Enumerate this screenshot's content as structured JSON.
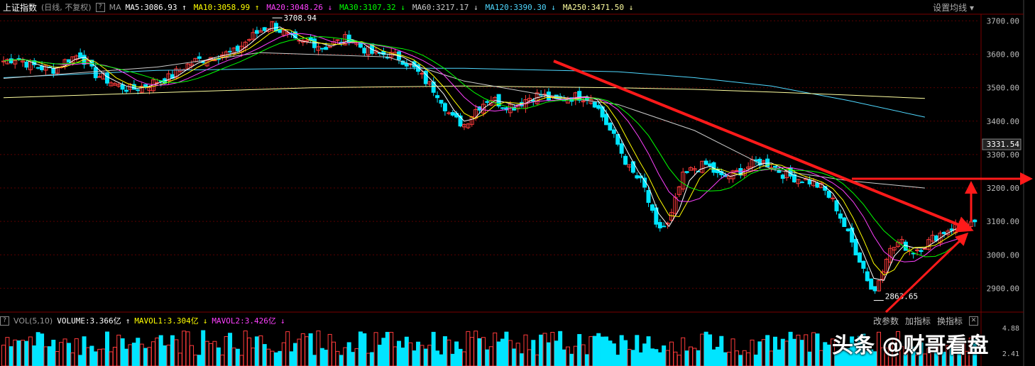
{
  "header": {
    "index_name": "上证指数",
    "period": "(日线, 不复权)",
    "ma_prefix": "MA",
    "settings_label": "设置均线",
    "ma": [
      {
        "label": "MA5:3086.93",
        "arrow": "↑",
        "color": "#ffffff"
      },
      {
        "label": "MA10:3058.99",
        "arrow": "↑",
        "color": "#ffff00"
      },
      {
        "label": "MA20:3048.26",
        "arrow": "↓",
        "color": "#ff40ff"
      },
      {
        "label": "MA30:3107.32",
        "arrow": "↓",
        "color": "#00ff00"
      },
      {
        "label": "MA60:3217.17",
        "arrow": "↓",
        "color": "#cccccc"
      },
      {
        "label": "MA120:3390.30",
        "arrow": "↓",
        "color": "#4fd8ff"
      },
      {
        "label": "MA250:3471.50",
        "arrow": "↓",
        "color": "#ffffa0"
      }
    ]
  },
  "vol_header": {
    "label": "VOL(5,10)",
    "volume": "VOLUME:3.366亿",
    "volume_arrow": "↑",
    "mavol1": "MAVOL1:3.304亿",
    "mavol1_arrow": "↓",
    "mavol2": "MAVOL2:3.426亿",
    "mavol2_arrow": "↓"
  },
  "vol_tools": [
    "改参数",
    "加指标",
    "换指标"
  ],
  "watermark": "头条 @财哥看盘",
  "price_axis": {
    "ticks": [
      "3700.00",
      "3600.00",
      "3500.00",
      "3400.00",
      "3300.00",
      "3200.00",
      "3100.00",
      "3000.00",
      "2900.00"
    ],
    "current": "3331.54"
  },
  "vol_axis_ticks": [
    "4.88",
    "2.41"
  ],
  "annotations": {
    "high_label": "3708.94",
    "low_label": "2863.65"
  },
  "colors": {
    "up": "#ff3b3b",
    "down": "#00e5ff",
    "arrow": "#ff1a1a",
    "grid": "#5a0000"
  },
  "chart_data": {
    "type": "candlestick",
    "ylim": [
      2850,
      3720
    ],
    "high": 3708.94,
    "low": 2863.65,
    "ma_series": {
      "MA120": [
        [
          0,
          3530
        ],
        [
          60,
          3552
        ],
        [
          120,
          3558
        ],
        [
          180,
          3558
        ],
        [
          240,
          3548
        ],
        [
          270,
          3530
        ],
        [
          300,
          3505
        ],
        [
          330,
          3462
        ],
        [
          360,
          3412
        ]
      ],
      "MA250": [
        [
          0,
          3470
        ],
        [
          60,
          3485
        ],
        [
          120,
          3500
        ],
        [
          180,
          3505
        ],
        [
          240,
          3500
        ],
        [
          270,
          3495
        ],
        [
          300,
          3487
        ],
        [
          330,
          3478
        ],
        [
          360,
          3468
        ]
      ],
      "MA60": [
        [
          0,
          3528
        ],
        [
          60,
          3562
        ],
        [
          100,
          3605
        ],
        [
          150,
          3592
        ],
        [
          180,
          3520
        ],
        [
          210,
          3480
        ],
        [
          240,
          3450
        ],
        [
          270,
          3372
        ],
        [
          300,
          3256
        ],
        [
          330,
          3222
        ],
        [
          360,
          3200
        ]
      ]
    },
    "close_path": [
      [
        0,
        3580
      ],
      [
        5,
        3590
      ],
      [
        10,
        3570
      ],
      [
        15,
        3560
      ],
      [
        20,
        3555
      ],
      [
        25,
        3585
      ],
      [
        30,
        3600
      ],
      [
        35,
        3545
      ],
      [
        40,
        3525
      ],
      [
        45,
        3505
      ],
      [
        50,
        3495
      ],
      [
        55,
        3505
      ],
      [
        60,
        3520
      ],
      [
        65,
        3530
      ],
      [
        70,
        3560
      ],
      [
        75,
        3580
      ],
      [
        80,
        3590
      ],
      [
        85,
        3600
      ],
      [
        90,
        3605
      ],
      [
        95,
        3640
      ],
      [
        100,
        3670
      ],
      [
        105,
        3690
      ],
      [
        110,
        3660
      ],
      [
        115,
        3630
      ],
      [
        120,
        3640
      ],
      [
        125,
        3620
      ],
      [
        130,
        3635
      ],
      [
        135,
        3650
      ],
      [
        140,
        3620
      ],
      [
        145,
        3600
      ],
      [
        150,
        3600
      ],
      [
        155,
        3590
      ],
      [
        160,
        3560
      ],
      [
        165,
        3520
      ],
      [
        170,
        3480
      ],
      [
        175,
        3410
      ],
      [
        180,
        3390
      ],
      [
        185,
        3440
      ],
      [
        190,
        3470
      ],
      [
        195,
        3450
      ],
      [
        200,
        3445
      ],
      [
        205,
        3470
      ],
      [
        210,
        3480
      ],
      [
        215,
        3460
      ],
      [
        220,
        3470
      ],
      [
        225,
        3475
      ],
      [
        230,
        3470
      ],
      [
        235,
        3400
      ],
      [
        240,
        3330
      ],
      [
        245,
        3250
      ],
      [
        250,
        3210
      ],
      [
        255,
        3080
      ],
      [
        260,
        3090
      ],
      [
        265,
        3230
      ],
      [
        270,
        3260
      ],
      [
        275,
        3270
      ],
      [
        280,
        3230
      ],
      [
        285,
        3240
      ],
      [
        290,
        3260
      ],
      [
        295,
        3280
      ],
      [
        300,
        3270
      ],
      [
        305,
        3240
      ],
      [
        310,
        3230
      ],
      [
        315,
        3220
      ],
      [
        320,
        3200
      ],
      [
        325,
        3150
      ],
      [
        330,
        3060
      ],
      [
        335,
        2980
      ],
      [
        340,
        2880
      ],
      [
        345,
        3000
      ],
      [
        350,
        3040
      ],
      [
        355,
        3010
      ],
      [
        360,
        3030
      ],
      [
        365,
        3060
      ],
      [
        370,
        3080
      ],
      [
        375,
        3090
      ],
      [
        380,
        3085
      ]
    ],
    "annotation_arrows": [
      {
        "from": [
          0.535,
          0.17
        ],
        "to": [
          0.945,
          0.61
        ],
        "kind": "downtrend"
      },
      {
        "from": [
          0.83,
          0.49
        ],
        "to": [
          1.0,
          0.49
        ],
        "kind": "resistance"
      },
      {
        "from": [
          0.84,
          0.86
        ],
        "to": [
          0.935,
          0.64
        ],
        "kind": "rebound"
      },
      {
        "from": [
          0.94,
          0.59
        ],
        "to": [
          0.94,
          0.49
        ],
        "kind": "target"
      }
    ]
  }
}
